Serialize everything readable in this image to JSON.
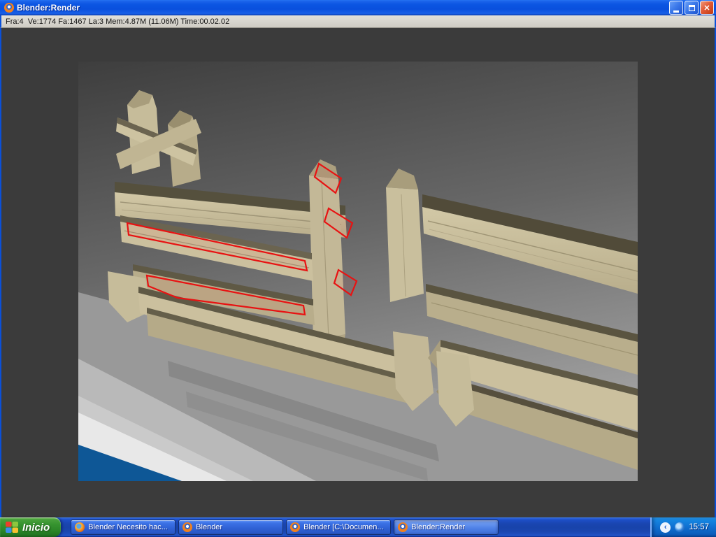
{
  "window": {
    "title": "Blender:Render",
    "icon": "blender-logo"
  },
  "stats_bar": {
    "text": "Fra:4  Ve:1774 Fa:1467 La:3 Mem:4.87M (11.06M) Time:00.02.02"
  },
  "taskbar": {
    "start_label": "Inicio",
    "buttons": [
      {
        "label": "Blender Necesito hac...",
        "icon": "firefox-icon",
        "active": false
      },
      {
        "label": "Blender",
        "icon": "blender-icon",
        "active": false
      },
      {
        "label": "Blender [C:\\Documen...",
        "icon": "blender-icon",
        "active": false
      },
      {
        "label": "Blender:Render",
        "icon": "blender-icon",
        "active": true
      }
    ],
    "tray": {
      "clock": "15:57"
    }
  },
  "colors": {
    "titlebar_blue": "#0a50dd",
    "taskbar_blue": "#1843aa",
    "start_green": "#2c8728",
    "viewport_gray": "#3b3b3b",
    "highlight_red": "#e81212",
    "wood_light": "#cbc09e",
    "wood_dark": "#55503d",
    "ground_blue": "#0e5796"
  }
}
